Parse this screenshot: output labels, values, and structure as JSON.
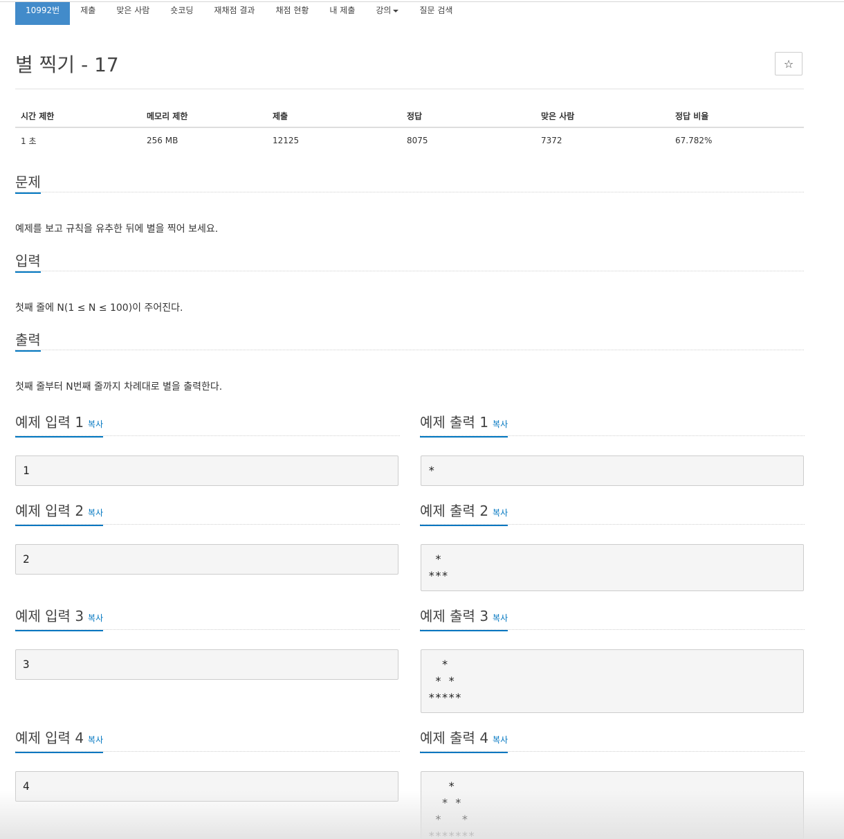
{
  "tabs": [
    "10992번",
    "제출",
    "맞은 사람",
    "숏코딩",
    "재채점 결과",
    "채점 현황",
    "내 제출",
    "강의",
    "질문 검색"
  ],
  "title": "별 찍기 - 17",
  "star_label": "☆",
  "info": {
    "headers": [
      "시간 제한",
      "메모리 제한",
      "제출",
      "정답",
      "맞은 사람",
      "정답 비율"
    ],
    "values": [
      "1 초",
      "256 MB",
      "12125",
      "8075",
      "7372",
      "67.782%"
    ]
  },
  "problem": {
    "title": "문제",
    "text": "예제를 보고 규칙을 유추한 뒤에 별을 찍어 보세요."
  },
  "input": {
    "title": "입력",
    "text": "첫째 줄에 N(1 ≤ N ≤ 100)이 주어진다."
  },
  "output": {
    "title": "출력",
    "text": "첫째 줄부터 N번째 줄까지 차례대로 별을 출력한다."
  },
  "copy_label": "복사",
  "samples": [
    {
      "in_title": "예제 입력 1",
      "in": "1",
      "out_title": "예제 출력 1",
      "out": "*"
    },
    {
      "in_title": "예제 입력 2",
      "in": "2",
      "out_title": "예제 출력 2",
      "out": " *\n***"
    },
    {
      "in_title": "예제 입력 3",
      "in": "3",
      "out_title": "예제 출력 3",
      "out": "  *\n * *\n*****"
    },
    {
      "in_title": "예제 입력 4",
      "in": "4",
      "out_title": "예제 출력 4",
      "out": "   *\n  * *\n *   *\n*******"
    }
  ]
}
